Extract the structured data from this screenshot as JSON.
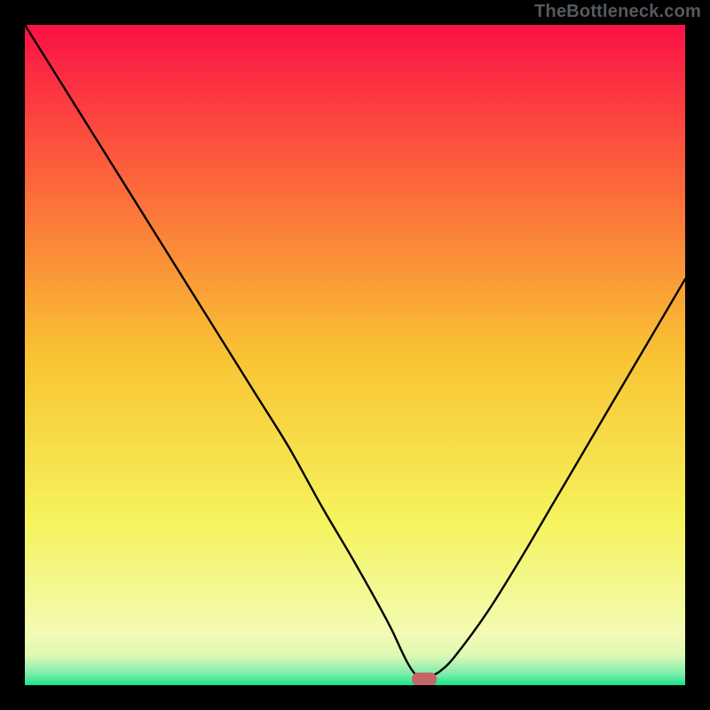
{
  "attribution": "TheBottleneck.com",
  "chart_data": {
    "type": "line",
    "title": "",
    "xlabel": "",
    "ylabel": "",
    "xlim": [
      0,
      100
    ],
    "ylim": [
      0,
      100
    ],
    "grid": false,
    "legend": false,
    "series": [
      {
        "name": "bottleneck-curve",
        "x": [
          0,
          5,
          10,
          15,
          20,
          25,
          30,
          35,
          40,
          45,
          50,
          55,
          57,
          58,
          59,
          60,
          61,
          62,
          63,
          65,
          70,
          75,
          80,
          85,
          90,
          95,
          100
        ],
        "values": [
          100,
          92,
          84,
          76,
          68,
          60,
          52,
          44,
          36,
          27,
          18.5,
          9.5,
          5.3,
          3.3,
          1.8,
          1.2,
          1.2,
          1.6,
          2.2,
          4.2,
          11,
          19,
          27.5,
          36,
          44.5,
          53,
          61.5
        ]
      }
    ],
    "marker": {
      "x": 60.5,
      "y": 0.9,
      "color": "#c56566",
      "shape": "rounded-bar"
    },
    "background_gradient": {
      "stops": [
        {
          "pos": 0.0,
          "color": "#fb1146"
        },
        {
          "pos": 0.25,
          "color": "#fc6b3b"
        },
        {
          "pos": 0.5,
          "color": "#f9c333"
        },
        {
          "pos": 0.75,
          "color": "#f5f35c"
        },
        {
          "pos": 0.92,
          "color": "#f3fbb3"
        },
        {
          "pos": 0.955,
          "color": "#dff8b4"
        },
        {
          "pos": 0.985,
          "color": "#75ecab"
        },
        {
          "pos": 1.0,
          "color": "#17e38a"
        }
      ]
    }
  }
}
